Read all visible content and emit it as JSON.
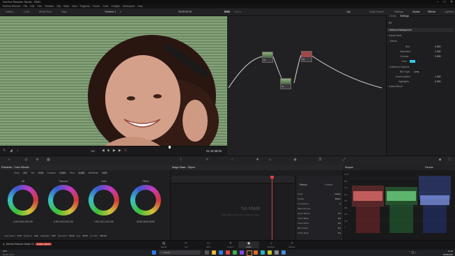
{
  "window": {
    "title": "DaVinci Resolve Studio - BMD",
    "controls": [
      "–",
      "□",
      "✕"
    ]
  },
  "menu": [
    "DaVinci Resolve",
    "File",
    "Edit",
    "Trim",
    "Timeline",
    "Clip",
    "Mark",
    "View",
    "Playback",
    "Fusion",
    "Color",
    "Fairlight",
    "Workspace",
    "Help"
  ],
  "toolbar": {
    "left_items": [
      "Gallery",
      "LUTs",
      "Media Pool",
      "Clips"
    ],
    "timeline_name": "Timeline 1",
    "timecode": "00:00:00:29",
    "project_name": "BMD",
    "project_status": "Edited",
    "zoom": "Clip",
    "right_items": [
      "Quick Export",
      "Settings",
      "Nodes",
      "Effects",
      "Lightbox"
    ]
  },
  "viewer": {
    "zoom_value": "100",
    "playback_timecode": "01:10:35:04"
  },
  "nodes_panel": {
    "node_labels": [
      "01",
      "02",
      "03"
    ]
  },
  "inspector": {
    "tabs": [
      "Library",
      "Settings"
    ],
    "section": "Fx",
    "effect_title": "Defocus Background",
    "groups": [
      {
        "name": "Adjust Mask",
        "rows": []
      },
      {
        "name": "Effects",
        "rows": [
          {
            "label": "Blur",
            "value": "0.500"
          },
          {
            "label": "Saturation",
            "value": "1.000"
          },
          {
            "label": "Colorize",
            "value": "0.000"
          },
          {
            "label": "Color",
            "value": ""
          }
        ]
      },
      {
        "name": "Advanced Options",
        "rows": [
          {
            "label": "Blur Type",
            "value": "Lens"
          },
          {
            "label": "Anamorphism",
            "value": "1.000"
          },
          {
            "label": "Highlights",
            "value": "0.000"
          }
        ]
      },
      {
        "name": "Global Blend",
        "rows": []
      }
    ],
    "colorize_swatch": "#38c8e8"
  },
  "color_panel": {
    "title": "Primaries - Color Wheels",
    "top_params": [
      {
        "label": "Temp",
        "value": "0.0"
      },
      {
        "label": "Tint",
        "value": "0.00"
      },
      {
        "label": "Contrast",
        "value": "1.000"
      },
      {
        "label": "Pivot",
        "value": "0.435"
      },
      {
        "label": "Mid/Detail",
        "value": "0.00"
      }
    ],
    "wheels": [
      {
        "name": "Lift",
        "values": "0.00  0.00  0.00  0.00"
      },
      {
        "name": "Gamma",
        "values": "0.00  0.00  0.00  0.00"
      },
      {
        "name": "Gain",
        "values": "1.00  1.00  1.00  1.00"
      },
      {
        "name": "Offset",
        "values": "25.00  25.00  25.00"
      }
    ],
    "bottom_params": [
      {
        "label": "Color Boost",
        "value": "0.00"
      },
      {
        "label": "Shadows",
        "value": "0.00"
      },
      {
        "label": "Highlights",
        "value": "0.00"
      },
      {
        "label": "Saturation",
        "value": "50.00"
      },
      {
        "label": "Hue",
        "value": "50.00"
      },
      {
        "label": "Lum Mix",
        "value": "100.00"
      }
    ]
  },
  "magic_mask": {
    "title": "Magic Mask - Object",
    "empty_text": "No Mask",
    "hint_text": "Click, draw or paint on an object to start",
    "side_tabs": [
      "Person",
      "Feature"
    ],
    "side_rows": [
      {
        "label": "Mode",
        "value": "Faster"
      },
      {
        "label": "Quality",
        "value": "Better"
      },
      {
        "label": "Consistency",
        "value": "0"
      },
      {
        "label": "Mask Finesse",
        "value": ""
      },
      {
        "label": "Smart Refine",
        "value": "0.0"
      },
      {
        "label": "Clean Black",
        "value": "0.0"
      },
      {
        "label": "Clean White",
        "value": "0.0"
      },
      {
        "label": "Blur Radius",
        "value": "0.0"
      },
      {
        "label": "In/Out Ratio",
        "value": "0.0"
      }
    ]
  },
  "scopes": {
    "title": "Scopes",
    "mode": "Parade",
    "scale": [
      "1023",
      "896",
      "768",
      "640",
      "512",
      "384",
      "256",
      "128",
      "0"
    ],
    "colors": {
      "red": "#e84848",
      "green": "#3ed05a",
      "blue": "#4a6ef0"
    }
  },
  "page_tabs": [
    "Media",
    "Cut",
    "Edit",
    "Fusion",
    "Color",
    "Fairlight",
    "Deliver"
  ],
  "status": {
    "app_name": "DaVinci Resolve Studio 18",
    "badge": "PUBLIC BETA"
  },
  "taskbar": {
    "weather_temp": "18°C",
    "weather_desc": "Mostly sunny",
    "search_placeholder": "Search",
    "clock_time": "12:10",
    "clock_date": "09/08/2023",
    "accent": "#2d7de0"
  }
}
